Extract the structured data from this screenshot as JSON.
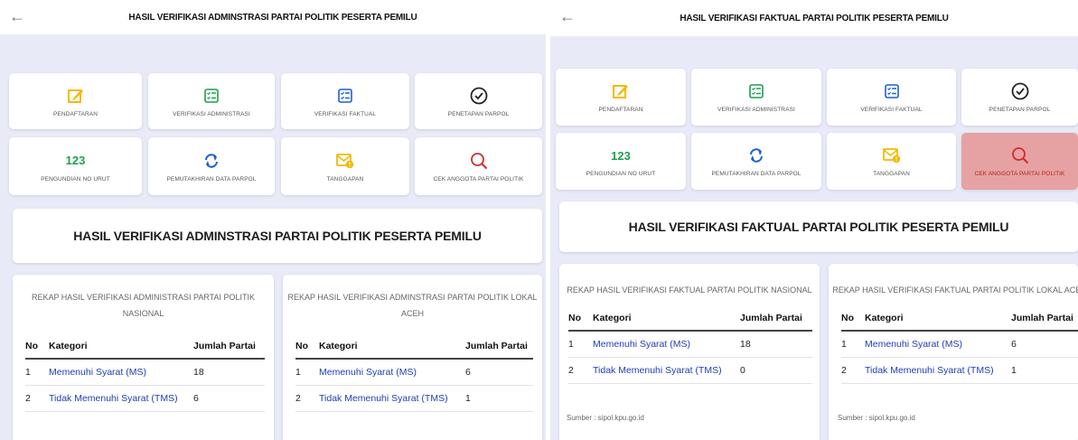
{
  "left": {
    "title": "HASIL VERIFIKASI ADMINSTRASI PARTAI POLITIK PESERTA PEMILU",
    "back_symbol": "←",
    "menu": [
      {
        "label": "PENDAFTARAN",
        "icon": "edit-icon"
      },
      {
        "label": "VERIFIKASI ADMINISTRASI",
        "icon": "checklist-icon"
      },
      {
        "label": "VERIFIKASI FAKTUAL",
        "icon": "checklist-icon"
      },
      {
        "label": "PENETAPAN PARPOL",
        "icon": "check-circle-icon"
      },
      {
        "label": "PENGUNDIAN NO URUT",
        "icon": "number-icon",
        "icon_text": "123"
      },
      {
        "label": "PEMUTAKHIRAN DATA PARPOL",
        "icon": "refresh-icon"
      },
      {
        "label": "TANGGAPAN",
        "icon": "mail-alert-icon"
      },
      {
        "label": "CEK ANGGOTA PARTAI POLITIK",
        "icon": "search-icon"
      }
    ],
    "heading": "HASIL VERIFIKASI ADMINSTRASI PARTAI POLITIK PESERTA PEMILU",
    "tables": [
      {
        "title_line1": "REKAP HASIL VERIFIKASI ADMINISTRASI PARTAI POLITIK",
        "title_line2": "NASIONAL",
        "headers": {
          "no": "No",
          "kategori": "Kategori",
          "jumlah": "Jumlah Partai"
        },
        "rows": [
          {
            "no": "1",
            "kategori": "Memenuhi Syarat (MS)",
            "jumlah": "18"
          },
          {
            "no": "2",
            "kategori": "Tidak Memenuhi Syarat (TMS)",
            "jumlah": "6"
          }
        ]
      },
      {
        "title_line1": "REKAP HASIL VERIFIKASI ADMINSTRASI PARTAI POLITIK LOKAL",
        "title_line2": "ACEH",
        "headers": {
          "no": "No",
          "kategori": "Kategori",
          "jumlah": "Jumlah Partai"
        },
        "rows": [
          {
            "no": "1",
            "kategori": "Memenuhi Syarat (MS)",
            "jumlah": "6"
          },
          {
            "no": "2",
            "kategori": "Tidak Memenuhi Syarat (TMS)",
            "jumlah": "1"
          }
        ]
      }
    ]
  },
  "right": {
    "title": "HASIL VERIFIKASI FAKTUAL PARTAI POLITIK PESERTA PEMILU",
    "back_symbol": "←",
    "menu": [
      {
        "label": "PENDAFTARAN",
        "icon": "edit-icon"
      },
      {
        "label": "VERIFIKASI ADMINISTRASI",
        "icon": "checklist-icon"
      },
      {
        "label": "VERIFIKASI FAKTUAL",
        "icon": "checklist-icon"
      },
      {
        "label": "PENETAPAN PARPOL",
        "icon": "check-circle-icon"
      },
      {
        "label": "PENGUNDIAN NO URUT",
        "icon": "number-icon",
        "icon_text": "123"
      },
      {
        "label": "PEMUTAKHIRAN DATA PARPOL",
        "icon": "refresh-icon"
      },
      {
        "label": "TANGGAPAN",
        "icon": "mail-alert-icon"
      },
      {
        "label": "CEK ANGGOTA PARTAI POLITIK",
        "icon": "search-icon",
        "active": true
      }
    ],
    "heading": "HASIL VERIFIKASI FAKTUAL PARTAI POLITIK PESERTA PEMILU",
    "tables": [
      {
        "title_line1": "REKAP HASIL VERIFIKASI FAKTUAL PARTAI POLITIK NASIONAL",
        "headers": {
          "no": "No",
          "kategori": "Kategori",
          "jumlah": "Jumlah Partai"
        },
        "rows": [
          {
            "no": "1",
            "kategori": "Memenuhi Syarat (MS)",
            "jumlah": "18"
          },
          {
            "no": "2",
            "kategori": "Tidak Memenuhi Syarat (TMS)",
            "jumlah": "0"
          }
        ],
        "sumber": "Sumber : sipol.kpu.go.id"
      },
      {
        "title_line1": "REKAP HASIL VERIFIKASI FAKTUAL PARTAI POLITIK LOKAL ACEH",
        "headers": {
          "no": "No",
          "kategori": "Kategori",
          "jumlah": "Jumlah Partai"
        },
        "rows": [
          {
            "no": "1",
            "kategori": "Memenuhi Syarat (MS)",
            "jumlah": "6"
          },
          {
            "no": "2",
            "kategori": "Tidak Memenuhi Syarat (TMS)",
            "jumlah": "1"
          }
        ],
        "sumber": "Sumber : sipol.kpu.go.id"
      }
    ]
  },
  "colors": {
    "accent_green": "#1f9d4e",
    "accent_blue": "#1d5fd1",
    "accent_yellow": "#f5b800",
    "accent_red": "#d22b2b",
    "link": "#1d3fb3",
    "active_card": "#e6a2a2"
  }
}
